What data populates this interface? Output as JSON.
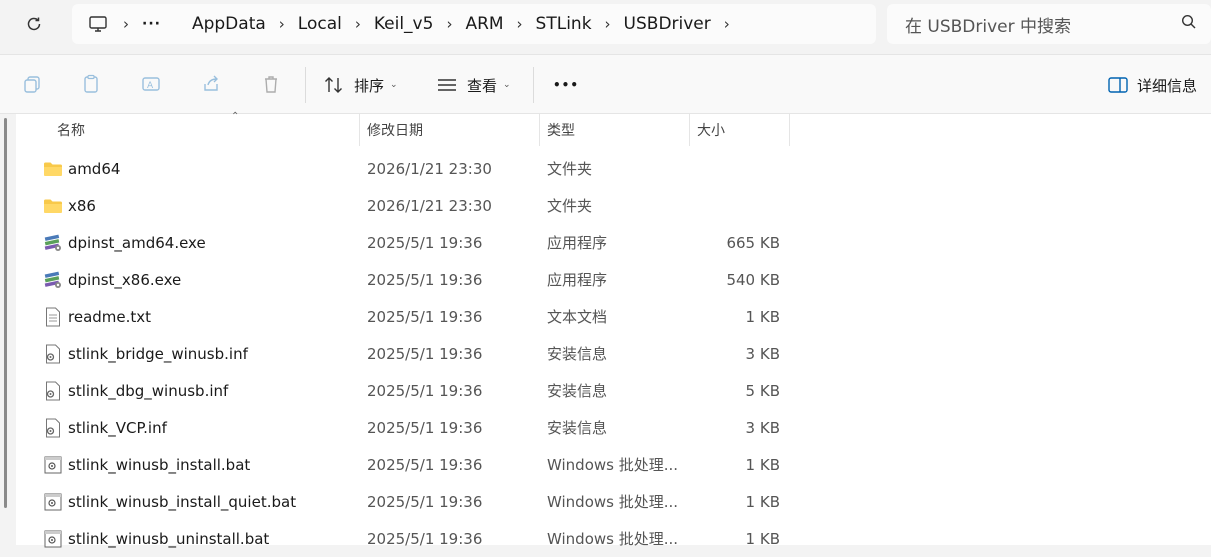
{
  "address_bar": {
    "overflow": "···",
    "crumbs": [
      "AppData",
      "Local",
      "Keil_v5",
      "ARM",
      "STLink",
      "USBDriver"
    ]
  },
  "search": {
    "placeholder": "在 USBDriver 中搜索"
  },
  "toolbar": {
    "sort_label": "排序",
    "view_label": "查看",
    "more_label": "•••",
    "details_label": "详细信息"
  },
  "columns": {
    "name": "名称",
    "date": "修改日期",
    "type": "类型",
    "size": "大小"
  },
  "files": [
    {
      "name": "amd64",
      "date": "2026/1/21 23:30",
      "type": "文件夹",
      "size": "",
      "icon": "folder-icon"
    },
    {
      "name": "x86",
      "date": "2026/1/21 23:30",
      "type": "文件夹",
      "size": "",
      "icon": "folder-icon"
    },
    {
      "name": "dpinst_amd64.exe",
      "date": "2025/5/1 19:36",
      "type": "应用程序",
      "size": "665 KB",
      "icon": "installer-exe-icon"
    },
    {
      "name": "dpinst_x86.exe",
      "date": "2025/5/1 19:36",
      "type": "应用程序",
      "size": "540 KB",
      "icon": "installer-exe-icon"
    },
    {
      "name": "readme.txt",
      "date": "2025/5/1 19:36",
      "type": "文本文档",
      "size": "1 KB",
      "icon": "text-file-icon"
    },
    {
      "name": "stlink_bridge_winusb.inf",
      "date": "2025/5/1 19:36",
      "type": "安装信息",
      "size": "3 KB",
      "icon": "inf-file-icon"
    },
    {
      "name": "stlink_dbg_winusb.inf",
      "date": "2025/5/1 19:36",
      "type": "安装信息",
      "size": "5 KB",
      "icon": "inf-file-icon"
    },
    {
      "name": "stlink_VCP.inf",
      "date": "2025/5/1 19:36",
      "type": "安装信息",
      "size": "3 KB",
      "icon": "inf-file-icon"
    },
    {
      "name": "stlink_winusb_install.bat",
      "date": "2025/5/1 19:36",
      "type": "Windows 批处理...",
      "size": "1 KB",
      "icon": "batch-file-icon"
    },
    {
      "name": "stlink_winusb_install_quiet.bat",
      "date": "2025/5/1 19:36",
      "type": "Windows 批处理...",
      "size": "1 KB",
      "icon": "batch-file-icon"
    },
    {
      "name": "stlink_winusb_uninstall.bat",
      "date": "2025/5/1 19:36",
      "type": "Windows 批处理...",
      "size": "1 KB",
      "icon": "batch-file-icon"
    }
  ],
  "colors": {
    "folder": "#f8c94a",
    "accent": "#0063b1"
  }
}
